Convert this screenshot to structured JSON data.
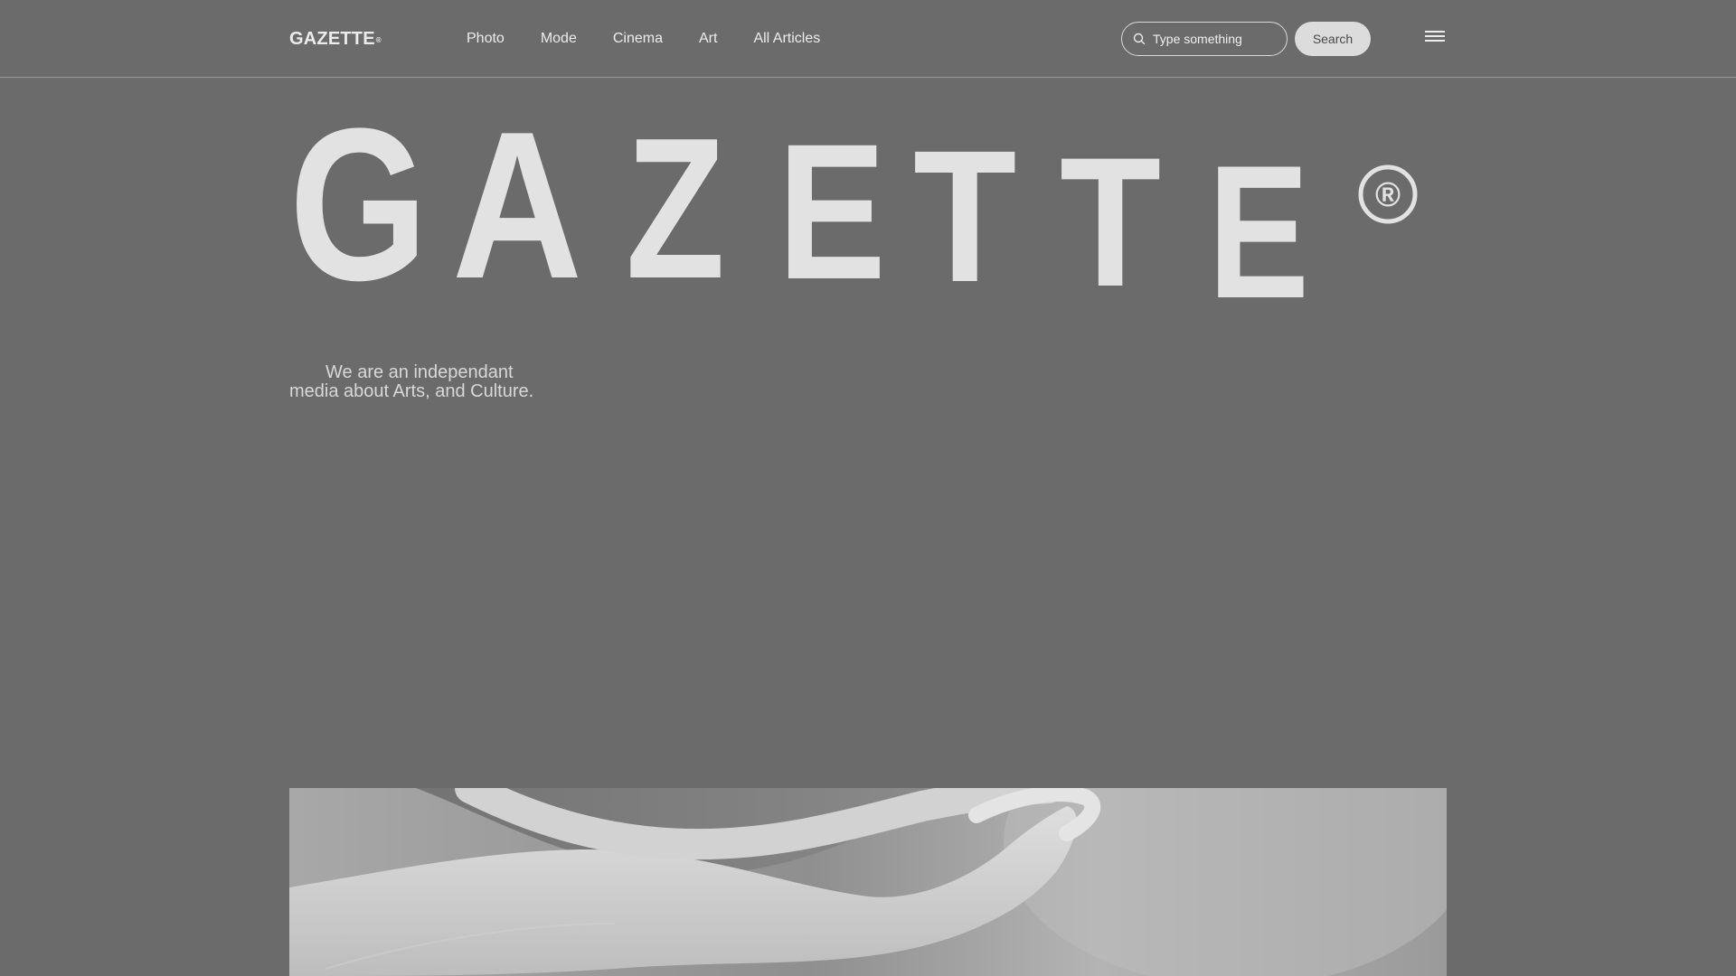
{
  "header": {
    "logo": "GAZETTE",
    "logo_mark": "®",
    "nav": [
      {
        "label": "Photo"
      },
      {
        "label": "Mode"
      },
      {
        "label": "Cinema"
      },
      {
        "label": "Art"
      },
      {
        "label": "All Articles"
      }
    ],
    "search": {
      "placeholder": "Type something",
      "value": "",
      "button_label": "Search",
      "icon": "search-icon"
    },
    "menu_icon": "hamburger-menu-icon"
  },
  "hero": {
    "letters": [
      "G",
      "A",
      "Z",
      "E",
      "T",
      "T",
      "E"
    ],
    "mark": "®",
    "tagline": "We are an independant media about Arts, and Culture."
  },
  "colors": {
    "background": "#6b6b6b",
    "text": "#e4e4e4",
    "button_bg": "#dcdcdc",
    "button_text": "#4a4a4a"
  }
}
